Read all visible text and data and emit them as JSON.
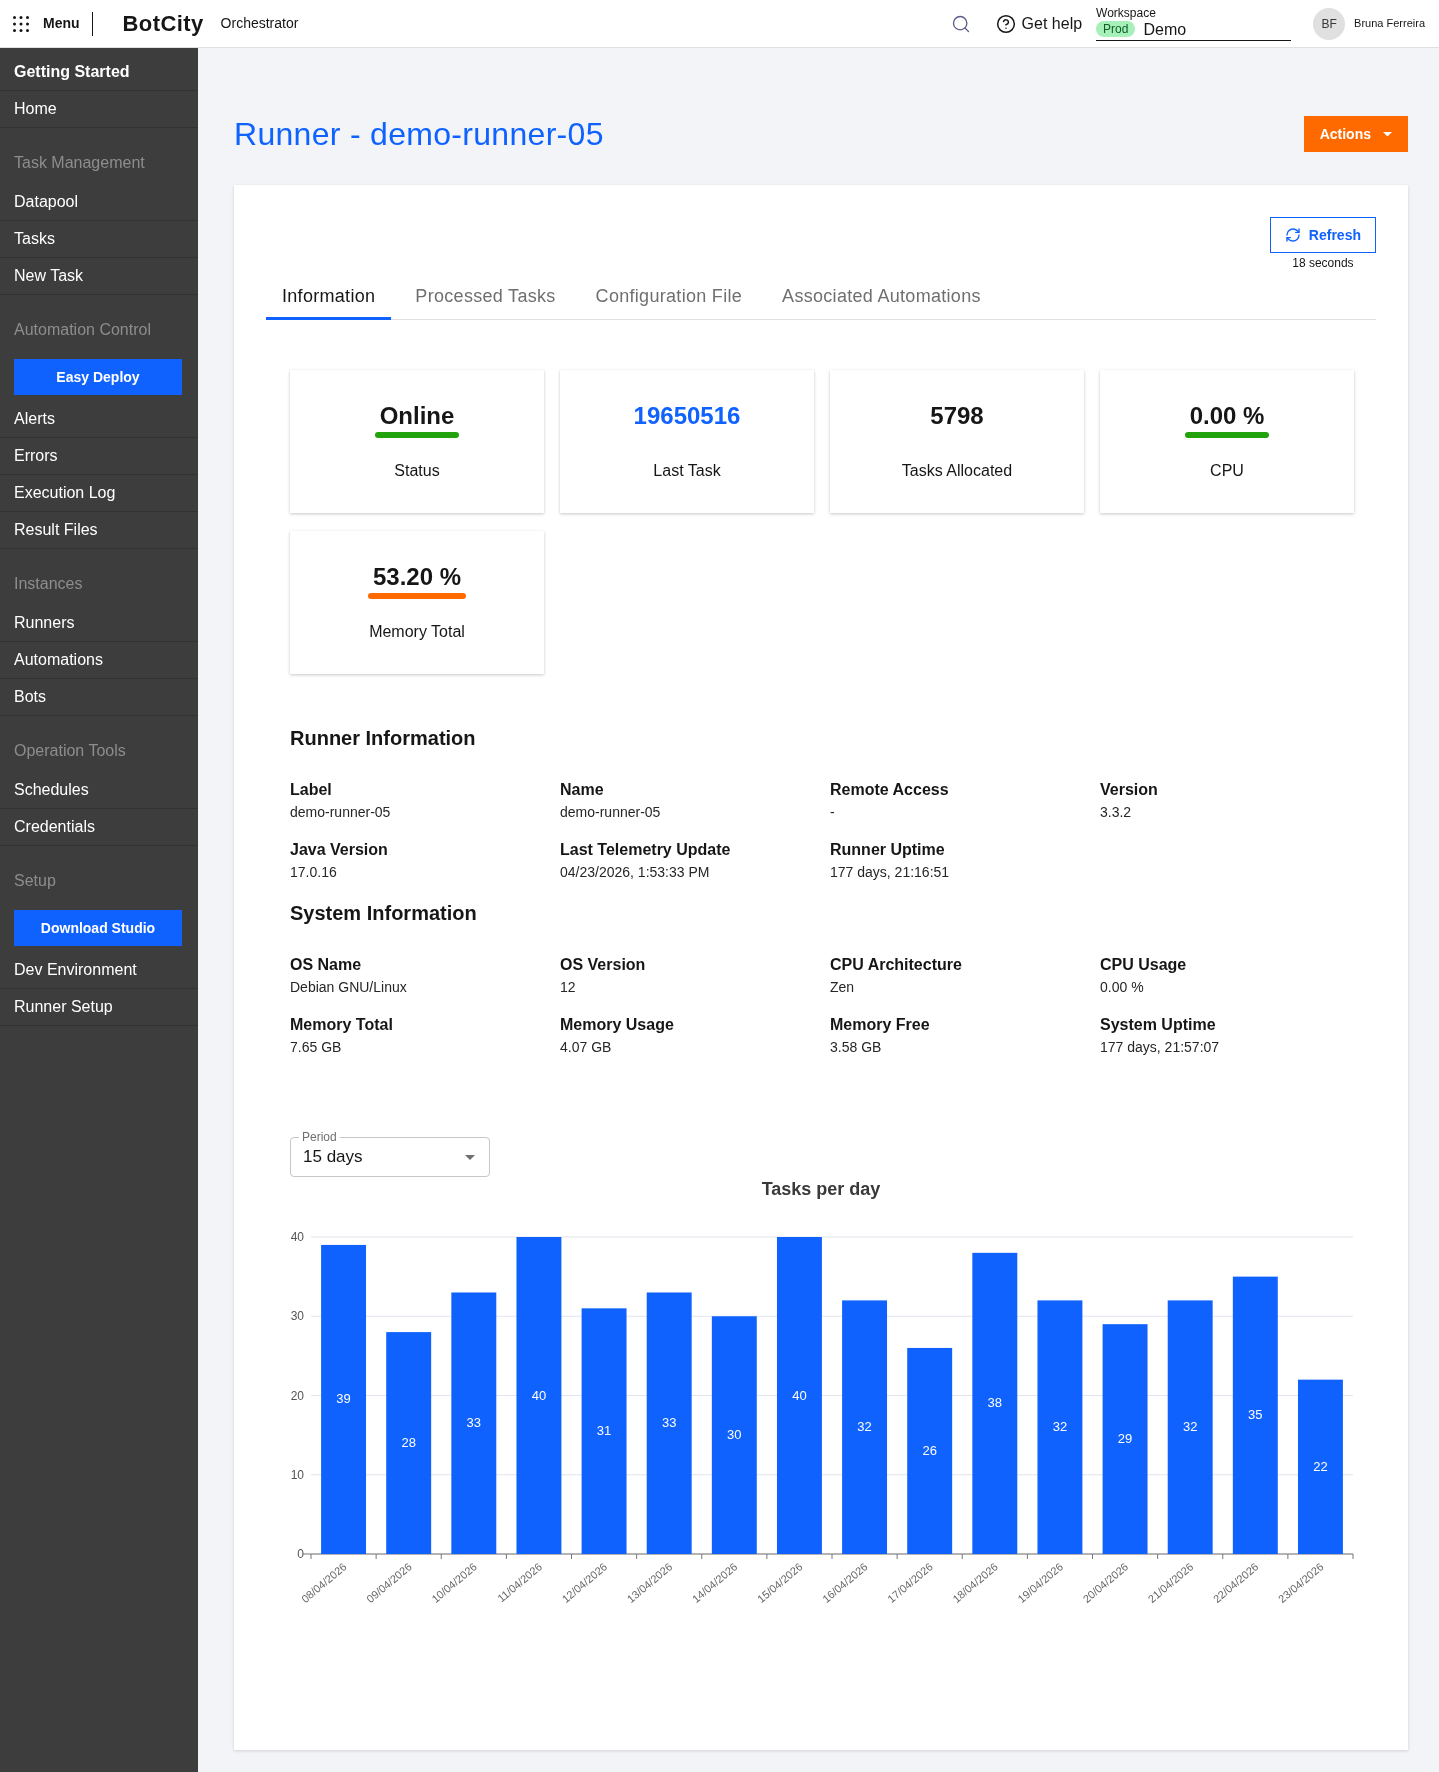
{
  "top_bar": {
    "menu_label": "Menu",
    "logo": "BotCity",
    "product": "Orchestrator",
    "help_label": "Get help",
    "workspace": {
      "label": "Workspace",
      "environment": "Prod",
      "name": "Demo"
    },
    "user": {
      "initials": "BF",
      "name": "Bruna Ferreira"
    }
  },
  "sidebar": {
    "sections": [
      {
        "kind": "primary",
        "title": "Getting Started",
        "items": [
          {
            "kind": "link",
            "label": "Home"
          }
        ]
      },
      {
        "kind": "group",
        "title": "Task Management",
        "items": [
          {
            "kind": "link",
            "label": "Datapool"
          },
          {
            "kind": "link",
            "label": "Tasks"
          },
          {
            "kind": "link",
            "label": "New Task"
          }
        ]
      },
      {
        "kind": "group",
        "title": "Automation Control",
        "items": [
          {
            "kind": "button",
            "label": "Easy Deploy"
          },
          {
            "kind": "link",
            "label": "Alerts"
          },
          {
            "kind": "link",
            "label": "Errors"
          },
          {
            "kind": "link",
            "label": "Execution Log"
          },
          {
            "kind": "link",
            "label": "Result Files"
          }
        ]
      },
      {
        "kind": "group",
        "title": "Instances",
        "items": [
          {
            "kind": "link",
            "label": "Runners"
          },
          {
            "kind": "link",
            "label": "Automations"
          },
          {
            "kind": "link",
            "label": "Bots"
          }
        ]
      },
      {
        "kind": "group",
        "title": "Operation Tools",
        "items": [
          {
            "kind": "link",
            "label": "Schedules"
          },
          {
            "kind": "link",
            "label": "Credentials"
          }
        ]
      },
      {
        "kind": "group",
        "title": "Setup",
        "items": [
          {
            "kind": "button",
            "label": "Download Studio"
          },
          {
            "kind": "link",
            "label": "Dev Environment"
          },
          {
            "kind": "link",
            "label": "Runner Setup"
          }
        ]
      }
    ]
  },
  "page": {
    "title": "Runner - demo-runner-05",
    "actions_label": "Actions"
  },
  "refresh": {
    "label": "Refresh",
    "elapsed": "18 seconds"
  },
  "tabs": [
    {
      "label": "Information",
      "selected": true
    },
    {
      "label": "Processed Tasks",
      "selected": false
    },
    {
      "label": "Configuration File",
      "selected": false
    },
    {
      "label": "Associated Automations",
      "selected": false
    }
  ],
  "stat_cards": [
    {
      "kind": "indicator",
      "value": "Online",
      "label": "Status",
      "color": "#22a30e"
    },
    {
      "kind": "link",
      "value": "19650516",
      "label": "Last Task"
    },
    {
      "kind": "plain",
      "value": "5798",
      "label": "Tasks Allocated"
    },
    {
      "kind": "indicator",
      "value": "0.00 %",
      "label": "CPU",
      "color": "#22a30e"
    },
    {
      "kind": "indicator",
      "value": "53.20 %",
      "label": "Memory Total",
      "color": "#ff6a00"
    }
  ],
  "info_sections": [
    {
      "title": "Runner Information",
      "fields": [
        {
          "label": "Label",
          "value": "demo-runner-05"
        },
        {
          "label": "Name",
          "value": "demo-runner-05"
        },
        {
          "label": "Remote Access",
          "value": "-"
        },
        {
          "label": "Version",
          "value": "3.3.2"
        },
        {
          "label": "Java Version",
          "value": "17.0.16"
        },
        {
          "label": "Last Telemetry Update",
          "value": "04/23/2026, 1:53:33 PM"
        },
        {
          "label": "Runner Uptime",
          "value": "177 days, 21:16:51"
        }
      ]
    },
    {
      "title": "System Information",
      "fields": [
        {
          "label": "OS Name",
          "value": "Debian GNU/Linux"
        },
        {
          "label": "OS Version",
          "value": "12"
        },
        {
          "label": "CPU Architecture",
          "value": "Zen"
        },
        {
          "label": "CPU Usage",
          "value": "0.00 %"
        },
        {
          "label": "Memory Total",
          "value": "7.65 GB"
        },
        {
          "label": "Memory Usage",
          "value": "4.07 GB"
        },
        {
          "label": "Memory Free",
          "value": "3.58 GB"
        },
        {
          "label": "System Uptime",
          "value": "177 days, 21:57:07"
        }
      ]
    }
  ],
  "period": {
    "label": "Period",
    "value": "15 days"
  },
  "chart_data": {
    "type": "bar",
    "title": "Tasks per day",
    "categories": [
      "08/04/2026",
      "09/04/2026",
      "10/04/2026",
      "11/04/2026",
      "12/04/2026",
      "13/04/2026",
      "14/04/2026",
      "15/04/2026",
      "16/04/2026",
      "17/04/2026",
      "18/04/2026",
      "19/04/2026",
      "20/04/2026",
      "21/04/2026",
      "22/04/2026",
      "23/04/2026"
    ],
    "values": [
      39,
      28,
      33,
      40,
      31,
      33,
      30,
      40,
      32,
      26,
      38,
      32,
      29,
      32,
      35,
      22
    ],
    "ylim": [
      0,
      40
    ],
    "yticks": [
      0,
      10,
      20,
      30,
      40
    ],
    "grid": true,
    "data_labels": true
  }
}
